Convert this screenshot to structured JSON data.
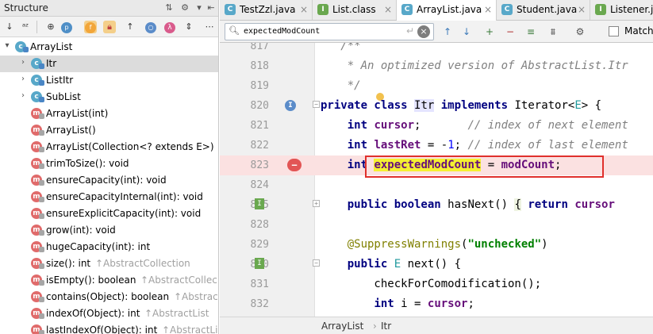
{
  "structure": {
    "title": "Structure",
    "tree": [
      {
        "label": "ArrayList",
        "icon": "class-icon",
        "glyph": "c",
        "expanded": true,
        "depth": 0
      },
      {
        "label": "Itr",
        "icon": "class-icon",
        "glyph": "c",
        "depth": 1,
        "selected": true
      },
      {
        "label": "ListItr",
        "icon": "class-icon",
        "glyph": "c",
        "depth": 1
      },
      {
        "label": "SubList",
        "icon": "class-icon",
        "glyph": "c",
        "depth": 1
      },
      {
        "label": "ArrayList(int)",
        "icon": "method-icon",
        "glyph": "m",
        "depth": 1
      },
      {
        "label": "ArrayList()",
        "icon": "method-icon",
        "glyph": "m",
        "depth": 1
      },
      {
        "label": "ArrayList(Collection<? extends E>)",
        "icon": "method-icon",
        "glyph": "m",
        "depth": 1
      },
      {
        "label": "trimToSize(): void",
        "icon": "method-icon",
        "glyph": "m",
        "depth": 1
      },
      {
        "label": "ensureCapacity(int): void",
        "icon": "method-icon",
        "glyph": "m",
        "depth": 1
      },
      {
        "label": "ensureCapacityInternal(int): void",
        "icon": "method-icon",
        "glyph": "m",
        "depth": 1
      },
      {
        "label": "ensureExplicitCapacity(int): void",
        "icon": "method-icon",
        "glyph": "m",
        "depth": 1
      },
      {
        "label": "grow(int): void",
        "icon": "method-icon",
        "glyph": "m",
        "depth": 1
      },
      {
        "label": "hugeCapacity(int): int",
        "icon": "method-icon",
        "glyph": "m",
        "depth": 1
      },
      {
        "label": "size(): int",
        "inherit": "↑AbstractCollection",
        "icon": "method-icon",
        "glyph": "m",
        "depth": 1
      },
      {
        "label": "isEmpty(): boolean",
        "inherit": "↑AbstractCollec",
        "icon": "method-icon",
        "glyph": "m",
        "depth": 1
      },
      {
        "label": "contains(Object): boolean",
        "inherit": "↑Abstrac",
        "icon": "method-icon",
        "glyph": "m",
        "depth": 1
      },
      {
        "label": "indexOf(Object): int",
        "inherit": "↑AbstractList",
        "icon": "method-icon",
        "glyph": "m",
        "depth": 1
      },
      {
        "label": "lastIndexOf(Object): int",
        "inherit": "↑AbstractLis",
        "icon": "method-icon",
        "glyph": "m",
        "depth": 1
      }
    ]
  },
  "tabs": [
    {
      "label": "TestZzl.java",
      "glyph": "C",
      "color": "#58a8c9"
    },
    {
      "label": "List.class",
      "glyph": "I",
      "color": "#6aa84f"
    },
    {
      "label": "ArrayList.java",
      "glyph": "C",
      "color": "#58a8c9",
      "active": true
    },
    {
      "label": "Student.java",
      "glyph": "C",
      "color": "#58a8c9"
    },
    {
      "label": "Listener.ja",
      "glyph": "I",
      "color": "#6aa84f"
    }
  ],
  "find": {
    "query": "expectedModCount",
    "match_case_label": "Match"
  },
  "code": {
    "line_numbers": [
      "817",
      "818",
      "819",
      "820",
      "821",
      "822",
      "823",
      "824",
      "825",
      "828",
      "829",
      "830",
      "831",
      "832"
    ]
  },
  "breadcrumb": [
    "ArrayList",
    "Itr"
  ]
}
